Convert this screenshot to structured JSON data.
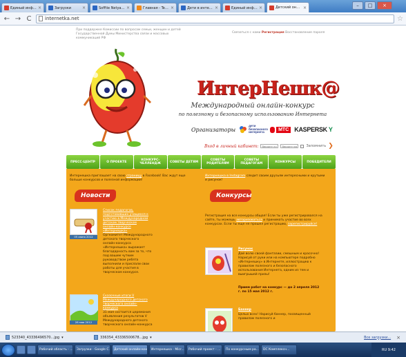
{
  "browser": {
    "tabs": [
      {
        "label": "Единый информацио",
        "favicon": "red"
      },
      {
        "label": "Загрузки",
        "favicon": "blue"
      },
      {
        "label": "Sofftie Netyas Partin",
        "favicon": "blue"
      },
      {
        "label": "Главная - Telensk.Ru",
        "favicon": "orange"
      },
      {
        "label": "Дети в интернете",
        "favicon": "blue"
      },
      {
        "label": "Единый информацио",
        "favicon": "red"
      },
      {
        "label": "Детский онлайн-кон",
        "favicon": "red",
        "active": true
      }
    ],
    "url": "internetka.net",
    "back_icon": "back-arrow-icon",
    "forward_icon": "forward-arrow-icon",
    "reload_icon": "reload-icon"
  },
  "page": {
    "topline_left": "При поддержке Комиссии по вопросам семьи, женщин и детей Государственной Думы Министерства связи и массовых коммуникаций РФ",
    "topline_right_a": "Связаться с нами",
    "topline_right_reg": "Регистрация",
    "topline_right_b": "Восстановление пароля",
    "logo": "ИнтерНешк@",
    "tagline_1": "Международный онлайн-конкурс",
    "tagline_2": "по полезному и безопасному использованию Интернета",
    "organizers_label": "Организаторы",
    "sponsor_deti": "дети безопасного интернета",
    "sponsor_mts": "МТС",
    "sponsor_kas_1": "KASPERSK",
    "sponsor_kas_2": "Y",
    "login_label": "Вход в личный кабинет:",
    "login_placeholder": "Введите логин",
    "password_placeholder": "Введите пароль",
    "remember_label": "Запомнить",
    "menu": [
      "ПРЕСС-ЦЕНТР",
      "О ПРОЕКТЕ",
      "КОНКУРС-ЧЕЛЛЕНДЖ",
      "СОВЕТЫ ДЕТЯМ",
      "СОВЕТЫ РОДИТЕЛЯМ",
      "СОВЕТЫ ПЕДАГОГАМ",
      "КОНКУРСЫ",
      "ПОБЕДИТЕЛИ"
    ],
    "left": {
      "intro_1": "Интернешка приглашает на свою",
      "intro_link": "страницу",
      "intro_2": "в Facebook! Вас ждут еще больше конкурсов и полезной информации!",
      "banner": "Новости",
      "news": [
        {
          "title": "Список педагогов, подготовивших учащихся к участию в Международном детском творческом онлайн-конкурсе «Интернешка»",
          "date": "05 июня 2012",
          "text": "Оргкомитет Международного детского творческого онлайн-конкурса «Интернешка» выражает благодарность вам за то, что под вашим чутким руководством ребята выполнили и прислали свои работы для участия в творческом конкурсе."
        },
        {
          "title": "Сказочные итоги V Международного детского творческого онлайн-конкурса",
          "date": "28 мая 2012",
          "text": "31 мая состоится церемония объявления результатов V Международного детского творческого онлайн-конкурса"
        }
      ]
    },
    "right": {
      "intro_1": "Интернешка в Instagram",
      "intro_2": "следит своим друзьям интересными и крутыми и рисунок!",
      "banner": "Конкурсы",
      "reg_1": "Регистрация на все конкурсы общая! Если ты уже регистрировался на сайте, ты можешь",
      "reg_link_1": "авторизоваться",
      "reg_2": "и принимать участие во всех конкурсах. Если ты еще не прошел регистрацию,",
      "reg_link_2": "зарегистрируйся!",
      "contests": [
        {
          "title": "Рисунок",
          "text": "Дай волю своей фантазии, смешным и красочно! Нарисуй от руки или на компьютере подробно «Интернешку» в Интернете, иллюстрацию к правилам полезного и безопасного использования Интернета, одним из тем и выигрышей призы!",
          "bold": "Прием работ на конкурс — до 2 апреля 2012 г. по 15 мая 2012 г."
        },
        {
          "title": "Баннер",
          "text": "Целых всех! Нарисуй баннер, посвященный правилам полезного и",
          "bold": ""
        }
      ]
    }
  },
  "downloads": {
    "items": [
      "523340_43336496570...jpg",
      "336354_43336500678...jpg"
    ],
    "show_all": "Все загрузки..."
  },
  "taskbar": {
    "tasks": [
      "Рабочий область - ...",
      "Загрузки - Google C...",
      "Детский онлайн-кон...",
      "Интернешка - Micr...",
      "Рабочий проект - ...",
      "По конкурсным ра...",
      "DC Комплексн..."
    ],
    "tray": "RU 9:42"
  }
}
